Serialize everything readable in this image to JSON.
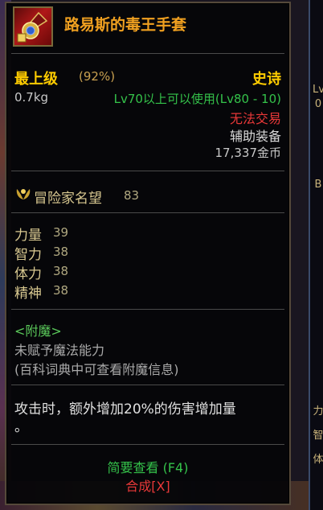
{
  "item": {
    "name": "路易斯的毒王手套",
    "icon": "glove-amulet-icon",
    "grade": "最上级",
    "grade_percent": "(92%)",
    "rarity": "史诗",
    "weight": "0.7kg",
    "level_req": "Lv70以上可以使用(Lv80 - 10)",
    "trade": "无法交易",
    "type": "辅助装备",
    "price": "17,337金币"
  },
  "fame": {
    "label": "冒险家名望",
    "value": "83"
  },
  "stats": [
    {
      "label": "力量",
      "value": "39"
    },
    {
      "label": "智力",
      "value": "38"
    },
    {
      "label": "体力",
      "value": "38"
    },
    {
      "label": "精神",
      "value": "38"
    }
  ],
  "enchant": {
    "title": "<附魔>",
    "line1": "未赋予魔法能力",
    "line2": "(百科词典中可查看附魔信息)"
  },
  "effect": {
    "line1": "攻击时，额外增加20%的伤害增加量",
    "line2": "。"
  },
  "footer": {
    "summary": "简要查看 (F4)",
    "combine": "合成[X]"
  },
  "side_panel": [
    "Lv",
    "0",
    "B",
    "力",
    "智",
    "体"
  ],
  "colors": {
    "name": "#f0a020",
    "rarity": "#ffcc00",
    "level": "#34c24a",
    "trade": "#e83838",
    "stat_label": "#d8c890",
    "stat_value": "#b0a880",
    "enchant": "#5ac85a",
    "muted": "#aaaaaa"
  }
}
